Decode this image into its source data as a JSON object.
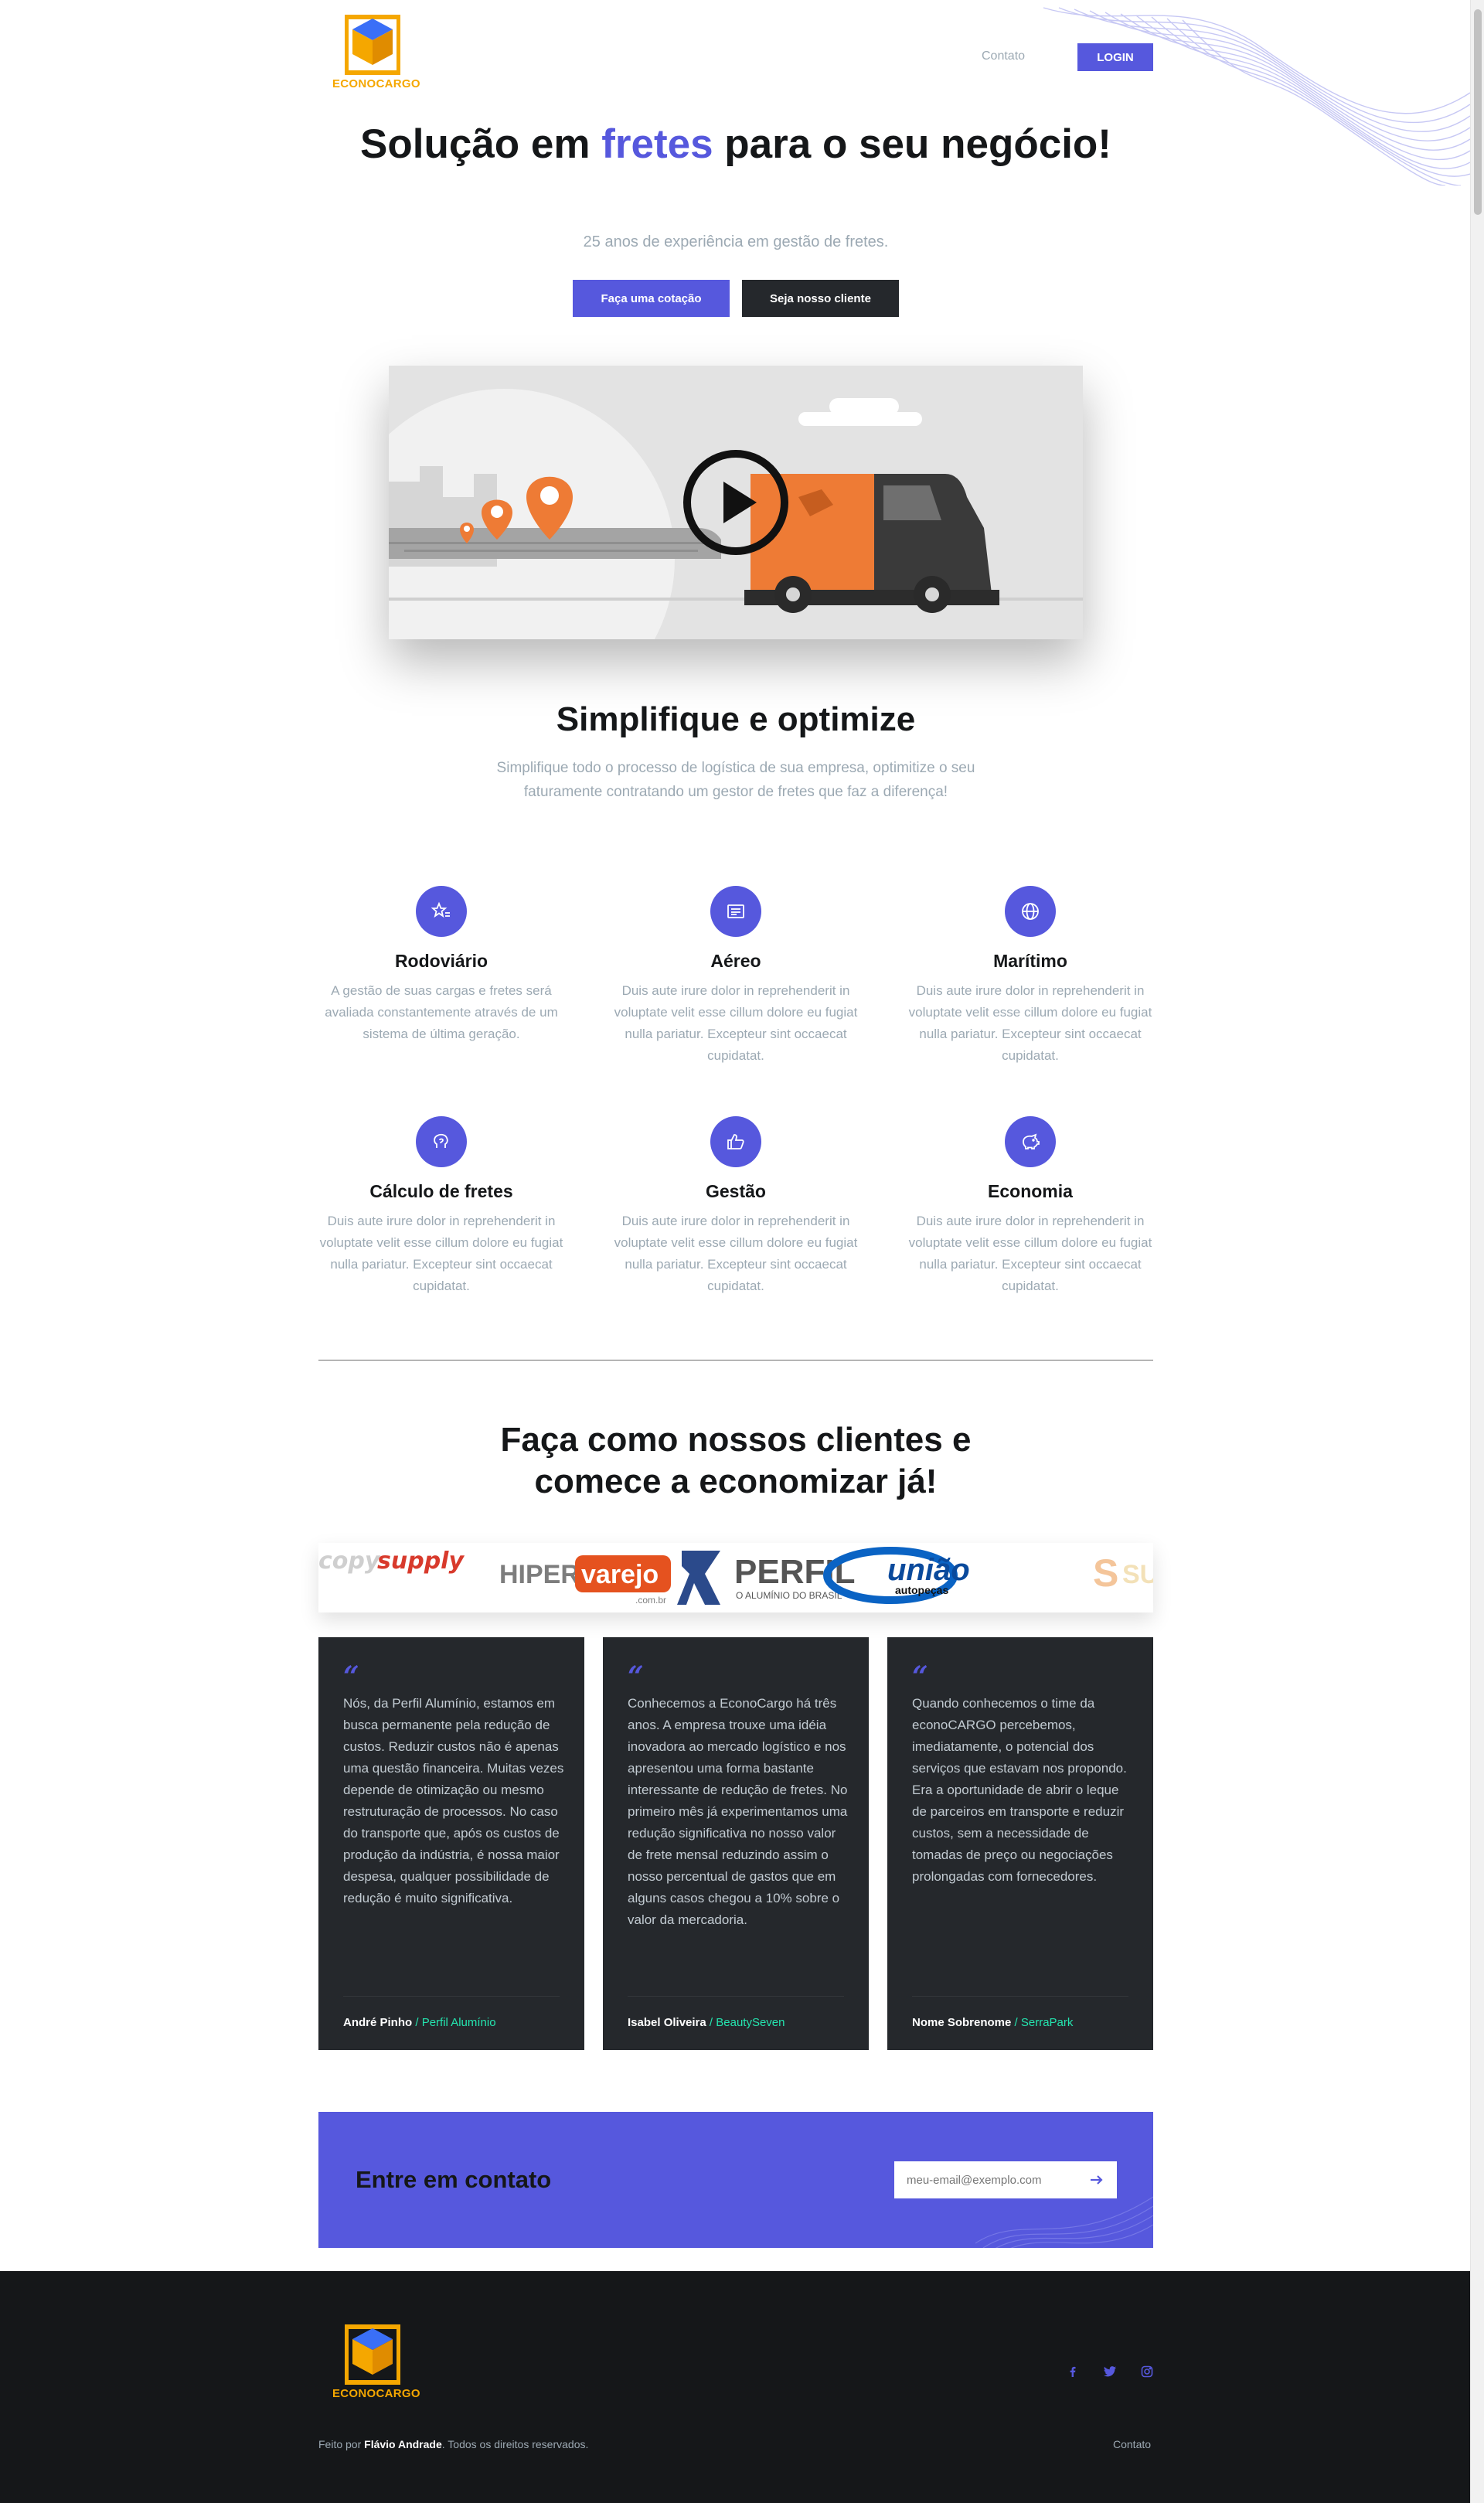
{
  "brand": {
    "name": "ECONOCARGO",
    "logo_color": "#f5a700",
    "cube_color": "#3a6ff7"
  },
  "nav": {
    "contact": "Contato",
    "login": "LOGIN"
  },
  "hero": {
    "title_before": "Solução em ",
    "title_accent": "fretes",
    "title_after": " para o seu negócio!",
    "subtitle": "25 anos de experiência em gestão de fretes.",
    "primary_cta": "Faça uma cotação",
    "secondary_cta": "Seja nosso cliente"
  },
  "video": {
    "icon": "play-icon"
  },
  "features": {
    "title": "Simplifique e optimize",
    "subtitle": "Simplifique todo o processo de logística de sua empresa, optimitize o seu faturamente contratando um gestor de fretes que faz a diferença!",
    "items": [
      {
        "icon": "star-list-icon",
        "title": "Rodoviário",
        "text": "A gestão de suas cargas e fretes será avaliada constantemente através de um sistema de última geração."
      },
      {
        "icon": "document-icon",
        "title": "Aéreo",
        "text": "Duis aute irure dolor in reprehenderit in voluptate velit esse cillum dolore eu fugiat nulla pariatur. Excepteur sint occaecat cupidatat."
      },
      {
        "icon": "globe-icon",
        "title": "Marítimo",
        "text": "Duis aute irure dolor in reprehenderit in voluptate velit esse cillum dolore eu fugiat nulla pariatur. Excepteur sint occaecat cupidatat."
      },
      {
        "icon": "brain-icon",
        "title": "Cálculo de fretes",
        "text": "Duis aute irure dolor in reprehenderit in voluptate velit esse cillum dolore eu fugiat nulla pariatur. Excepteur sint occaecat cupidatat."
      },
      {
        "icon": "thumbs-up-icon",
        "title": "Gestão",
        "text": "Duis aute irure dolor in reprehenderit in voluptate velit esse cillum dolore eu fugiat nulla pariatur. Excepteur sint occaecat cupidatat."
      },
      {
        "icon": "piggy-bank-icon",
        "title": "Economia",
        "text": "Duis aute irure dolor in reprehenderit in voluptate velit esse cillum dolore eu fugiat nulla pariatur. Excepteur sint occaecat cupidatat."
      }
    ]
  },
  "clients": {
    "title_line1": "Faça como nossos clientes e",
    "title_line2": "comece a economizar já!",
    "logos": [
      {
        "name": "copysupply",
        "text_a": "copy",
        "text_b": "supply"
      },
      {
        "name": "hipervarejo",
        "text_a": "HIPER",
        "text_b": "varejo",
        "text_c": ".com.br"
      },
      {
        "name": "perfil",
        "text_a": "PERFIL",
        "text_b": "O ALUMÍNIO DO BRASIL"
      },
      {
        "name": "uniao",
        "text_a": "união",
        "text_b": "autopeças"
      },
      {
        "name": "partial-s",
        "text_a": "S",
        "text_b": "SU"
      }
    ]
  },
  "testimonials": [
    {
      "quote_mark": "“",
      "text": "Nós, da Perfil Alumínio, estamos em busca permanente pela redução de custos. Reduzir custos não é apenas uma questão financeira. Muitas vezes depende de otimização ou mesmo restruturação de processos. No caso do transporte que, após os custos de produção da indústria, é nossa maior despesa, qualquer possibilidade de redução é muito significativa.",
      "author": "André Pinho",
      "separator": " / ",
      "company": "Perfil Alumínio"
    },
    {
      "quote_mark": "“",
      "text": "Conhecemos a EconoCargo há três anos. A empresa trouxe uma idéia inovadora ao mercado logístico e nos apresentou uma forma bastante interessante de redução de fretes. No primeiro mês já experimentamos uma redução significativa no nosso valor de frete mensal reduzindo assim o nosso percentual de gastos que em alguns casos chegou a 10% sobre o valor da mercadoria.",
      "author": "Isabel Oliveira",
      "separator": " / ",
      "company": "BeautySeven"
    },
    {
      "quote_mark": "“",
      "text": "Quando conhecemos o time da econoCARGO percebemos, imediatamente, o potencial dos serviços que estavam nos propondo. Era a oportunidade de abrir o leque de parceiros em transporte e reduzir custos, sem a necessidade de tomadas de preço ou negociações prolongadas com fornecedores.",
      "author": "Nome Sobrenome",
      "separator": " / ",
      "company": "SerraPark"
    }
  ],
  "cta": {
    "title": "Entre em contato",
    "email_placeholder": "meu-email@exemplo.com",
    "submit_icon": "arrow-right-icon"
  },
  "footer": {
    "social": [
      "facebook-icon",
      "twitter-icon",
      "instagram-icon"
    ],
    "made_by_prefix": "Feito por ",
    "made_by_name": "Flávio Andrade",
    "rights": ". Todos os direitos reservados.",
    "contact": "Contato"
  },
  "colors": {
    "accent": "#5658dd",
    "dark": "#25282c",
    "footer_bg": "#151719",
    "muted": "#9ca9b3",
    "company": "#24e5af"
  }
}
